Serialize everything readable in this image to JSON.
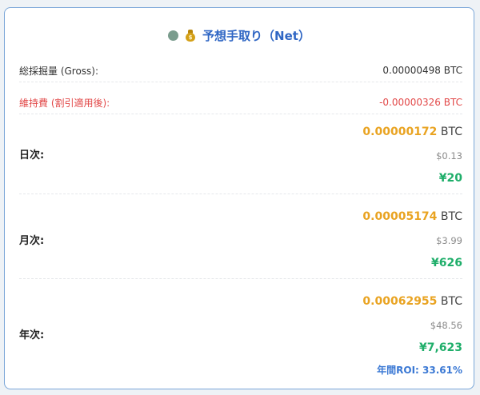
{
  "header": {
    "title": "予想手取り（Net）",
    "status_color": "#7a9c8d"
  },
  "gross": {
    "label": "総採掘量 (Gross):",
    "value": "0.00000498 BTC"
  },
  "maintenance": {
    "label": "維持費 (割引適用後):",
    "value": "-0.00000326 BTC"
  },
  "periods": [
    {
      "label": "日次:",
      "btc_value": "0.00000172",
      "btc_unit": "BTC",
      "usd": "$0.13",
      "jpy": "¥20"
    },
    {
      "label": "月次:",
      "btc_value": "0.00005174",
      "btc_unit": "BTC",
      "usd": "$3.99",
      "jpy": "¥626"
    },
    {
      "label": "年次:",
      "btc_value": "0.00062955",
      "btc_unit": "BTC",
      "usd": "$48.56",
      "jpy": "¥7,623",
      "roi": "年間ROI: 33.61%"
    }
  ],
  "colors": {
    "btc": "#e9a321",
    "jpy": "#1fae6a",
    "maintenance": "#e24848",
    "roi": "#3a78d4",
    "title": "#2f66c4"
  }
}
